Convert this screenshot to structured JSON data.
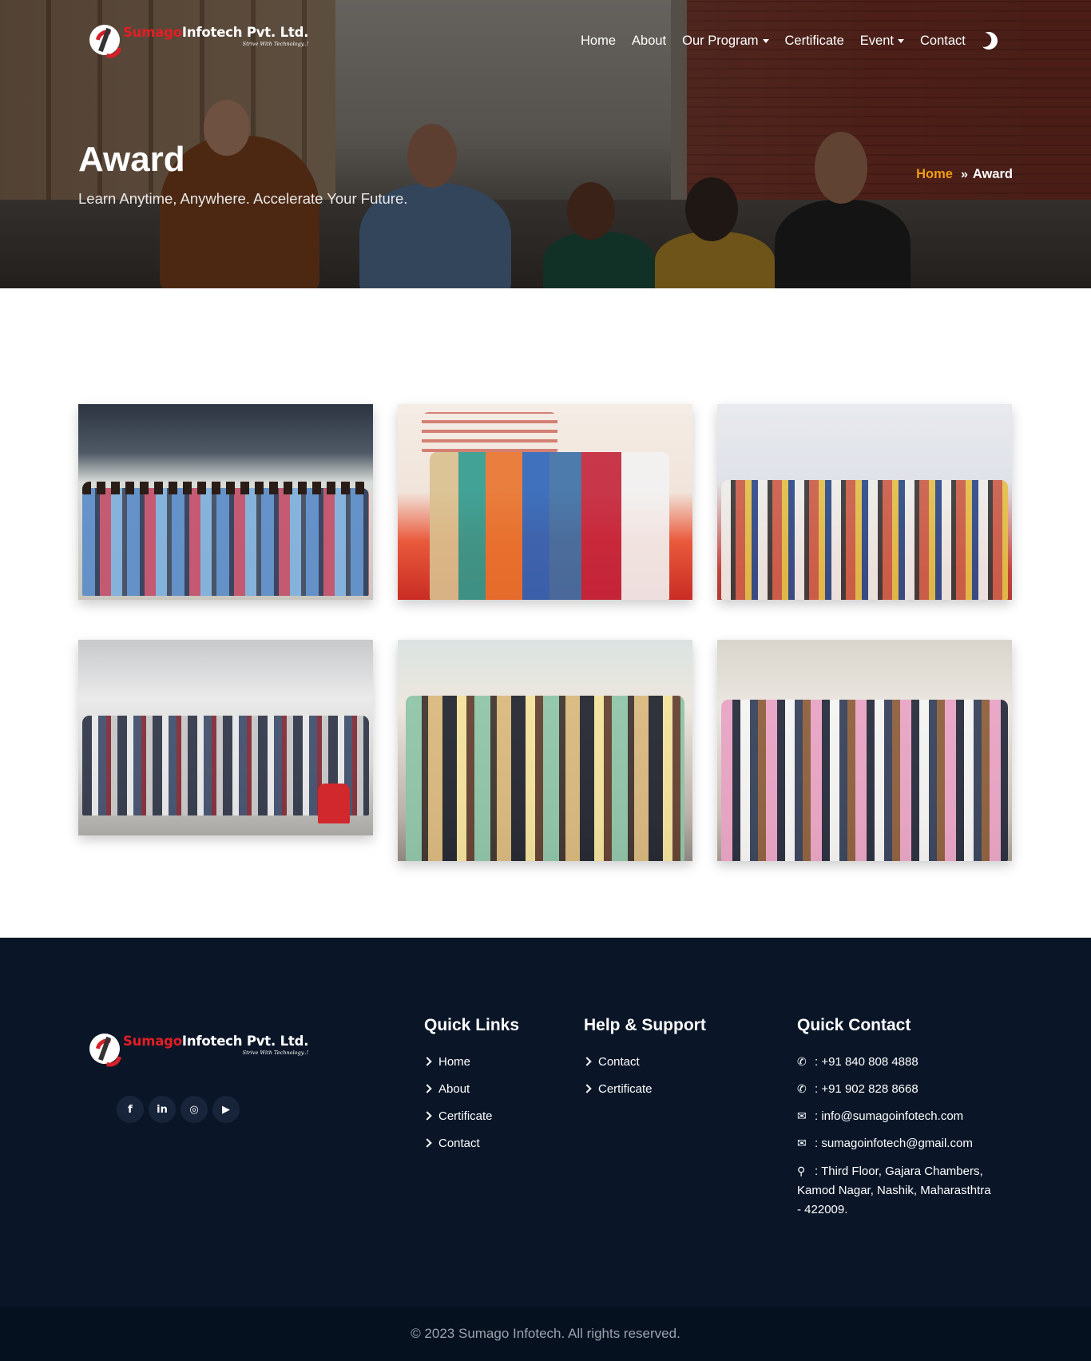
{
  "brand": {
    "name_red": "Sumago",
    "name_white": "Infotech Pvt. Ltd.",
    "tagline": "Strive With Technology..!"
  },
  "nav": {
    "items": [
      {
        "label": "Home",
        "dropdown": false
      },
      {
        "label": "About",
        "dropdown": false
      },
      {
        "label": "Our Program",
        "dropdown": true
      },
      {
        "label": "Certificate",
        "dropdown": false
      },
      {
        "label": "Event",
        "dropdown": true
      },
      {
        "label": "Contact",
        "dropdown": false
      }
    ],
    "theme_toggle_icon": "moon-icon"
  },
  "hero": {
    "title": "Award",
    "subtitle": "Learn Anytime, Anywhere. Accelerate Your Future.",
    "breadcrumb": {
      "home": "Home",
      "separator": "»",
      "current": "Award"
    }
  },
  "gallery": {
    "photos": [
      {
        "alt": "award-photo-1"
      },
      {
        "alt": "award-photo-2"
      },
      {
        "alt": "award-photo-3"
      },
      {
        "alt": "award-photo-4"
      },
      {
        "alt": "award-photo-5"
      },
      {
        "alt": "award-photo-6"
      }
    ]
  },
  "footer": {
    "socials": [
      {
        "icon": "facebook-icon",
        "glyph": "f"
      },
      {
        "icon": "linkedin-icon",
        "glyph": "in"
      },
      {
        "icon": "instagram-icon",
        "glyph": "◎"
      },
      {
        "icon": "youtube-icon",
        "glyph": "▶"
      }
    ],
    "quick_links": {
      "heading": "Quick Links",
      "items": [
        "Home",
        "About",
        "Certificate",
        "Contact"
      ]
    },
    "help_support": {
      "heading": "Help & Support",
      "items": [
        "Contact",
        "Certificate"
      ]
    },
    "quick_contact": {
      "heading": "Quick Contact",
      "phone1": ": +91 840 808 4888",
      "phone2": ": +91 902 828 8668",
      "email1": ": info@sumagoinfotech.com",
      "email2": ": sumagoinfotech@gmail.com",
      "address": ": Third Floor, Gajara Chambers, Kamod Nagar, Nashik, Maharasthtra - 422009."
    },
    "copyright": "© 2023 Sumago Infotech. All rights reserved."
  },
  "colors": {
    "accent": "#f39c12",
    "brand_red": "#e31e24",
    "footer_bg": "#0a1628"
  }
}
